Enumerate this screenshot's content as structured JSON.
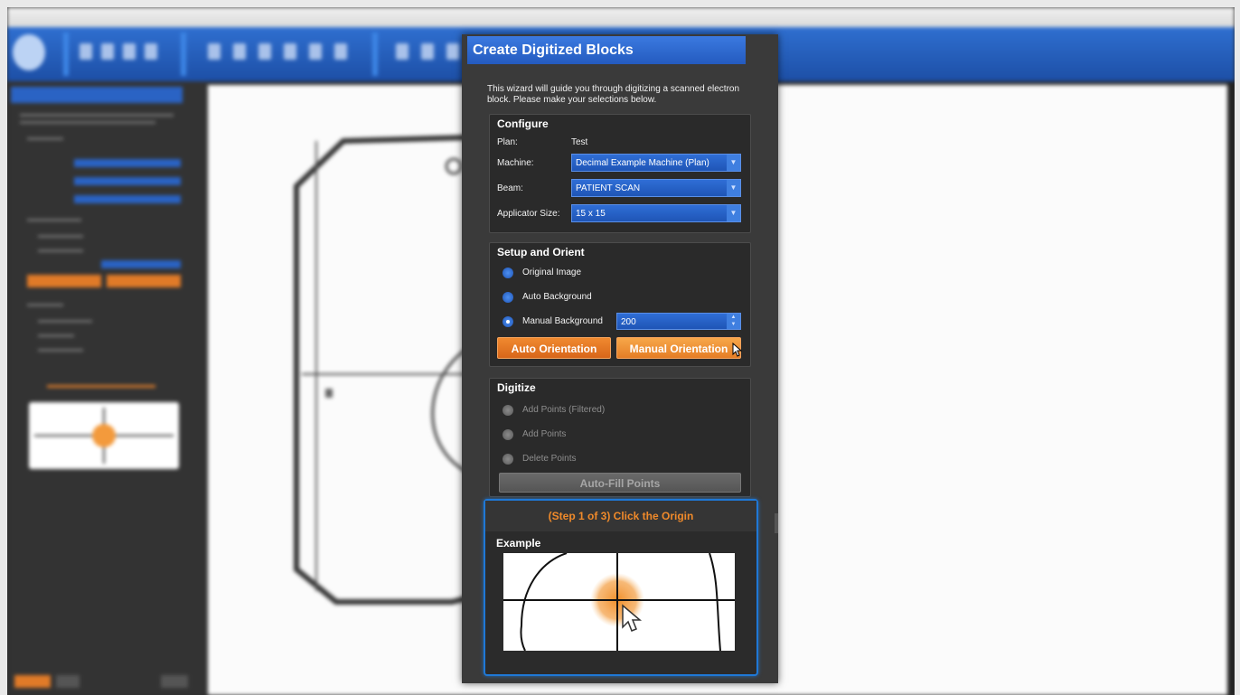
{
  "wizard": {
    "title": "Create Digitized Blocks",
    "intro": "This wizard will guide you through digitizing a scanned electron block. Please make your selections below.",
    "configure": {
      "title": "Configure",
      "plan_label": "Plan:",
      "plan_value": "Test",
      "machine_label": "Machine:",
      "machine_value": "Decimal Example Machine (Plan)",
      "beam_label": "Beam:",
      "beam_value": "PATIENT SCAN",
      "applicator_label": "Applicator Size:",
      "applicator_value": "15 x 15"
    },
    "setup": {
      "title": "Setup and Orient",
      "options": [
        "Original Image",
        "Auto Background",
        "Manual Background"
      ],
      "selected": "Manual Background",
      "manual_background_value": "200",
      "auto_orientation_label": "Auto Orientation",
      "manual_orientation_label": "Manual Orientation"
    },
    "digitize": {
      "title": "Digitize",
      "options": [
        "Add Points (Filtered)",
        "Add Points",
        "Delete Points"
      ],
      "autofill_label": "Auto-Fill Points"
    },
    "step": {
      "title": "(Step 1 of 3) Click the Origin",
      "example_label": "Example"
    }
  },
  "colors": {
    "accent_blue": "#2a63c4",
    "accent_orange": "#e87a28",
    "step_text": "#f08a2a",
    "dialog_bg": "#3a3a3a"
  }
}
